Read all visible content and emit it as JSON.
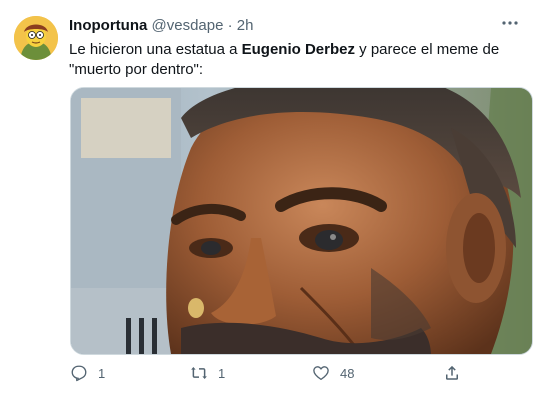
{
  "tweet": {
    "author_name": "Inoportuna",
    "handle": "@vesdape",
    "separator": "·",
    "time": "2h",
    "text_part1": "Le hicieron una estatua a ",
    "text_bold": "Eugenio Derbez",
    "text_part2": " y parece el meme de \"muerto por dentro\":"
  },
  "actions": {
    "reply_count": "1",
    "retweet_count": "1",
    "like_count": "48"
  },
  "icons": {
    "reply": "reply-icon",
    "retweet": "retweet-icon",
    "like": "heart-icon",
    "share": "share-icon",
    "more": "more-options-icon"
  },
  "colors": {
    "text": "#0f1419",
    "secondary": "#536471",
    "border": "#cfd9de"
  }
}
